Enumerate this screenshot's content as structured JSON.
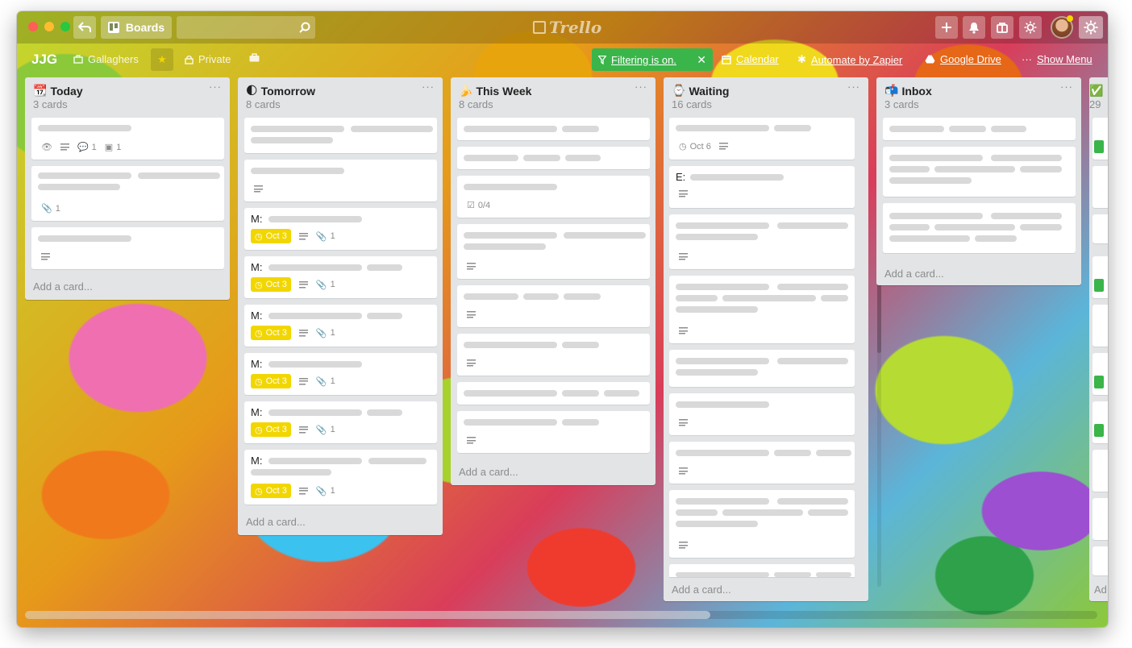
{
  "header": {
    "boards_label": "Boards",
    "logo_text": "Trello"
  },
  "board": {
    "name": "JJG",
    "team": "Gallaghers",
    "visibility": "Private"
  },
  "filter": {
    "label": "Filtering is on."
  },
  "powerups": {
    "calendar": "Calendar",
    "automate": "Automate by Zapier",
    "drive": "Google Drive",
    "menu": "Show Menu"
  },
  "lists": [
    {
      "title": "Today",
      "emoji": "📆",
      "count": "3 cards",
      "add": "Add a card..."
    },
    {
      "title": "Tomorrow",
      "emoji": "🌓",
      "count": "8 cards",
      "add": "Add a card..."
    },
    {
      "title": "This Week",
      "emoji": "🍌",
      "count": "8 cards",
      "add": "Add a card..."
    },
    {
      "title": "Waiting",
      "emoji": "⌚",
      "count": "16 cards",
      "add": "Add a card..."
    },
    {
      "title": "Inbox",
      "emoji": "📬",
      "count": "3 cards",
      "add": "Add a card..."
    },
    {
      "title": "",
      "emoji": "✅",
      "count": "29",
      "add": "Ad"
    }
  ],
  "badges": {
    "today_c1_comments": "1",
    "today_c1_checklist": "1",
    "today_c2_attach": "1",
    "tomorrow_prefix": "M:",
    "tomorrow_due": "Oct 3",
    "tomorrow_attach": "1",
    "week_checklist": "0/4",
    "waiting_due": "Oct 6",
    "waiting_prefix": "E:"
  },
  "colors": {
    "due_yellow": "#f2d600",
    "filter_green": "#3ab54a",
    "list_bg": "#e2e4e6"
  }
}
